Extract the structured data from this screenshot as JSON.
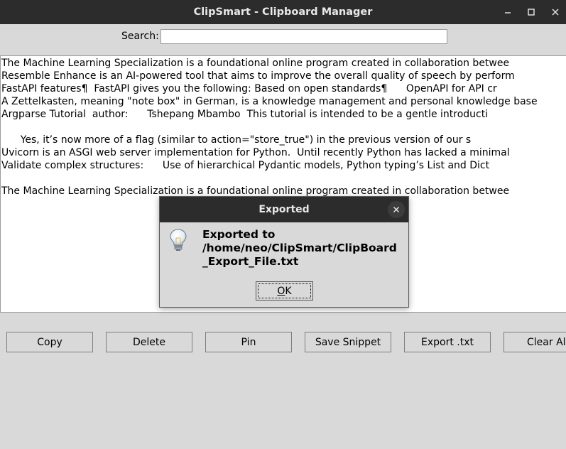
{
  "window": {
    "title": "ClipSmart - Clipboard Manager"
  },
  "search": {
    "label": "Search:",
    "value": "",
    "placeholder": ""
  },
  "clips": [
    "The Machine Learning Specialization is a foundational online program created in collaboration betwee",
    "Resemble Enhance is an AI-powered tool that aims to improve the overall quality of speech by perform",
    "FastAPI features¶  FastAPI gives you the following: Based on open standards¶      OpenAPI for API cr",
    "A Zettelkasten, meaning \"note box\" in German, is a knowledge management and personal knowledge base",
    "Argparse Tutorial  author:      Tshepang Mbambo  This tutorial is intended to be a gentle introducti",
    "",
    "      Yes, it’s now more of a flag (similar to action=\"store_true\") in the previous version of our s",
    "Uvicorn is an ASGI web server implementation for Python.  Until recently Python has lacked a minimal",
    "Validate complex structures:      Use of hierarchical Pydantic models, Python typing’s List and Dict",
    "",
    "The Machine Learning Specialization is a foundational online program created in collaboration betwee"
  ],
  "buttons": {
    "copy": "Copy",
    "delete": "Delete",
    "pin": "Pin",
    "save_snippet": "Save Snippet",
    "export_txt": "Export .txt",
    "clear_all": "Clear All"
  },
  "dialog": {
    "title": "Exported",
    "message_line1": "Exported to",
    "message_line2": "/home/neo/ClipSmart/ClipBoard",
    "message_line3": "_Export_File.txt",
    "ok_mnemonic": "O",
    "ok_rest": "K",
    "icon": "lightbulb-icon"
  }
}
